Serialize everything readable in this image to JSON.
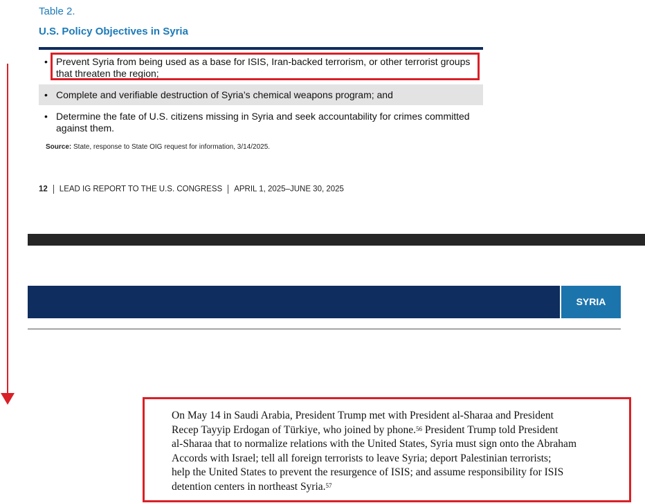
{
  "table": {
    "label": "Table 2.",
    "title": "U.S. Policy Objectives in Syria",
    "bullet": "•",
    "rows": [
      "Prevent Syria from being used as a base for ISIS, Iran-backed terrorism, or other terrorist groups that threaten the region;",
      "Complete and verifiable destruction of Syria’s chemical weapons program; and",
      "Determine the fate of U.S. citizens missing in Syria and seek accountability for crimes committed against them."
    ],
    "source_label": "Source:",
    "source_text": " State, response to State OIG request for information, 3/14/2025."
  },
  "footer": {
    "page_number": "12",
    "report_title": "LEAD IG REPORT TO THE U.S. CONGRESS",
    "period": "APRIL 1, 2025–JUNE 30, 2025"
  },
  "section": {
    "tab_label": "SYRIA"
  },
  "paragraph": {
    "line1": "On May 14 in Saudi Arabia, President Trump met with President al-Sharaa and President",
    "line2": "Recep Tayyip Erdogan of Türkiye, who joined by phone.",
    "ref1": "56",
    "line2b": " President Trump told President",
    "line3": "al-Sharaa that to normalize relations with the United States, Syria must sign onto the Abraham",
    "line4": "Accords with Israel; tell all foreign terrorists to leave Syria; deport Palestinian terrorists;",
    "line5": "help the United States to prevent the resurgence of ISIS; and assume responsibility for ISIS",
    "line6": "detention centers in northeast Syria.",
    "ref2": "57"
  },
  "colors": {
    "accent_blue": "#1c7ab8",
    "navy": "#0f2d5e",
    "highlight_red": "#d92027"
  }
}
